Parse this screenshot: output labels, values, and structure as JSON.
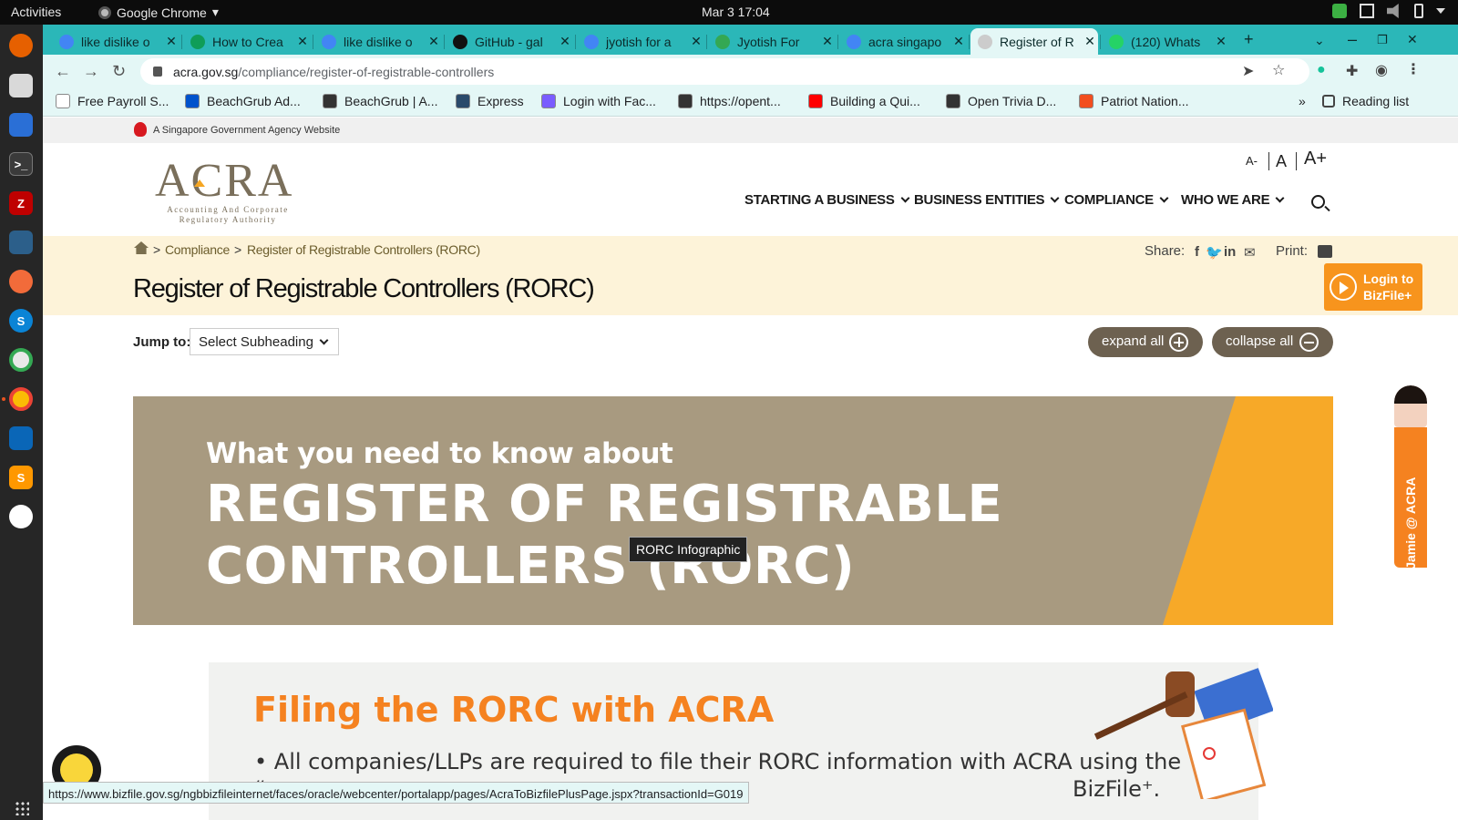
{
  "desktop": {
    "activities": "Activities",
    "app_name": "Google Chrome",
    "clock": "Mar 3  17:04"
  },
  "tabs": [
    {
      "title": "like dislike o",
      "icon": "google-g-icon",
      "color": "#4285f4"
    },
    {
      "title": "How to Crea",
      "icon": "green-link-icon",
      "color": "#0f9d58"
    },
    {
      "title": "like dislike o",
      "icon": "google-g-icon",
      "color": "#4285f4"
    },
    {
      "title": "GitHub - gal",
      "icon": "github-icon",
      "color": "#111111"
    },
    {
      "title": "jyotish for a",
      "icon": "google-g-icon",
      "color": "#4285f4"
    },
    {
      "title": "Jyotish For",
      "icon": "play-store-icon",
      "color": "#34a853"
    },
    {
      "title": "acra singapo",
      "icon": "google-g-icon",
      "color": "#4285f4"
    },
    {
      "title": "Register of R",
      "icon": "acra-favicon",
      "color": "#cccccc",
      "active": true
    },
    {
      "title": "(120) Whats",
      "icon": "whatsapp-icon",
      "color": "#25d366"
    }
  ],
  "omnibox": {
    "host": "acra.gov.sg",
    "path": "/compliance/register-of-registrable-controllers"
  },
  "bookmarks": [
    {
      "label": "Free Payroll S...",
      "icon": "y-icon",
      "color": "#ffffff"
    },
    {
      "label": "BeachGrub Ad...",
      "icon": "trello-icon",
      "color": "#0052cc"
    },
    {
      "label": "BeachGrub | A...",
      "icon": "globe-icon",
      "color": "#333333"
    },
    {
      "label": "Express",
      "icon": "express-icon",
      "color": "#2a4a6b"
    },
    {
      "label": "Login with Fac...",
      "icon": "gear-icon",
      "color": "#7a5cff"
    },
    {
      "label": "https://opent...",
      "icon": "globe-icon",
      "color": "#333333"
    },
    {
      "label": "Building a Qui...",
      "icon": "youtube-icon",
      "color": "#ff0000"
    },
    {
      "label": "Open Trivia D...",
      "icon": "globe-icon",
      "color": "#333333"
    },
    {
      "label": "Patriot Nation...",
      "icon": "figma-icon",
      "color": "#f24e1e"
    }
  ],
  "reading_list": "Reading list",
  "gov_banner": "A Singapore Government Agency Website",
  "logo": {
    "word": "ACRA",
    "subtitle_1": "Accounting And Corporate",
    "subtitle_2": "Regulatory Authority"
  },
  "font_controls": [
    "A-",
    "A",
    "A+"
  ],
  "nav": [
    "STARTING A BUSINESS",
    "BUSINESS ENTITIES",
    "COMPLIANCE",
    "WHO WE ARE"
  ],
  "breadcrumb": {
    "sep": ">",
    "level1": "Compliance",
    "level2": "Register of Registrable Controllers (RORC)"
  },
  "share_label": "Share:",
  "print_label": "Print:",
  "page_title": "Register of Registrable Controllers (RORC)",
  "bizfile": {
    "line1": "Login to",
    "line2": "BizFile+"
  },
  "jump": {
    "label": "Jump to:",
    "select_value": "Select Subheading"
  },
  "expand_all": "expand all",
  "collapse_all": "collapse all",
  "banner": {
    "line1": "What you need to know about",
    "line2": "REGISTER OF REGISTRABLE",
    "line3": "CONTROLLERS (RORC)"
  },
  "tooltip": "RORC Infographic",
  "infographic": {
    "title": "Filing the RORC with ACRA",
    "bullet": "• All companies/LLPs are required to file their RORC information with ACRA using the",
    "line2_start": "“",
    "line2_end": "BizFile⁺."
  },
  "ask_jamie": "Ask Jamie @ ACRA",
  "status_url": "https://www.bizfile.gov.sg/ngbbizfileinternet/faces/oracle/webcenter/portalapp/pages/AcraToBizfilePlusPage.jspx?transactionId=G019",
  "colors": {
    "accent": "#f58220",
    "brand_brown": "#6d6150",
    "tab_bar": "#2bb7b8"
  }
}
